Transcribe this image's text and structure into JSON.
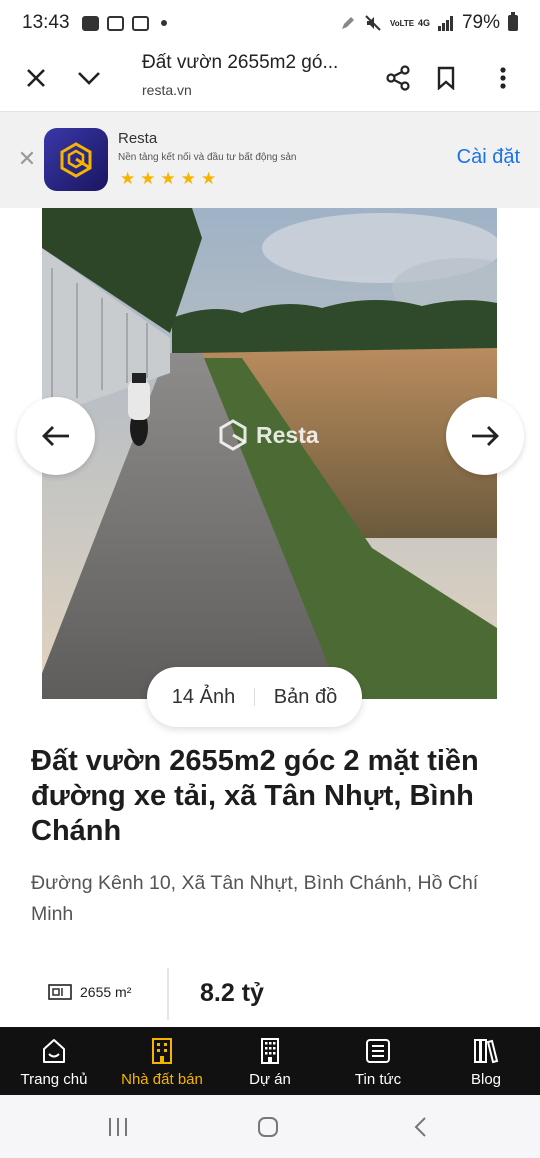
{
  "status_bar": {
    "time": "13:43",
    "battery": "79%",
    "network": "4G",
    "volte": "VoLTE"
  },
  "browser": {
    "page_title": "Đất vườn 2655m2 gó...",
    "url": "resta.vn"
  },
  "app_banner": {
    "app_name": "Resta",
    "tagline": "Nền tảng kết nối và đầu tư bất động sản",
    "rating_stars": 5,
    "install_label": "Cài đặt",
    "brand_color": "#2f2a8f"
  },
  "gallery": {
    "watermark": "Resta",
    "photos_label": "14 Ảnh",
    "map_label": "Bản đồ"
  },
  "listing": {
    "title": "Đất vườn 2655m2 góc 2 mặt tiền đường xe tải, xã Tân Nhựt, Bình Chánh",
    "address": "Đường Kênh 10, Xã Tân Nhựt, Bình Chánh, Hồ Chí Minh",
    "area": "2655 m²",
    "price": "8.2 tỷ"
  },
  "bottom_nav": {
    "items": [
      {
        "label": "Trang chủ",
        "icon": "home-icon"
      },
      {
        "label": "Nhà đất bán",
        "icon": "building-icon",
        "active": true
      },
      {
        "label": "Dự án",
        "icon": "apartment-icon"
      },
      {
        "label": "Tin tức",
        "icon": "news-icon"
      },
      {
        "label": "Blog",
        "icon": "books-icon"
      }
    ],
    "active_color": "#f5b400"
  }
}
